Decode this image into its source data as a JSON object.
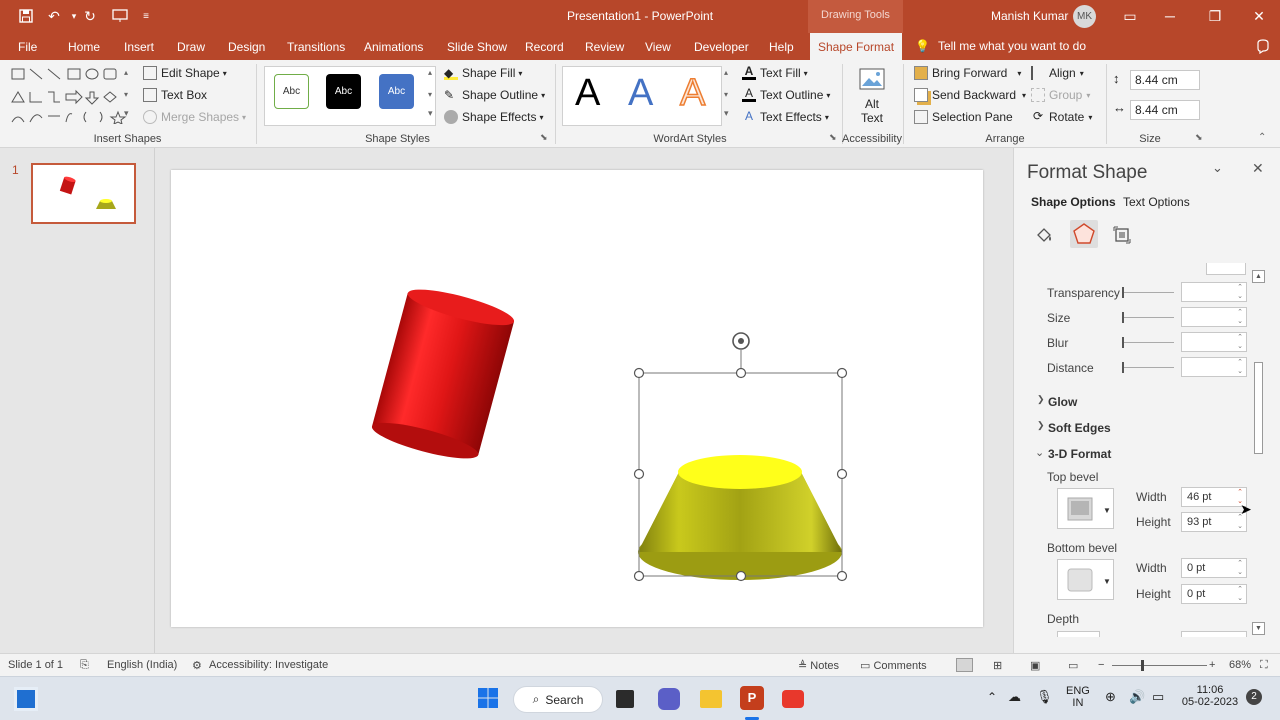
{
  "titlebar": {
    "title": "Presentation1 - PowerPoint",
    "context_label": "Drawing Tools",
    "user": "Manish Kumar",
    "avatar": "MK"
  },
  "tabs": [
    "File",
    "Home",
    "Insert",
    "Draw",
    "Design",
    "Transitions",
    "Animations",
    "Slide Show",
    "Record",
    "Review",
    "View",
    "Developer",
    "Help",
    "Shape Format"
  ],
  "tell_me": "Tell me what you want to do",
  "ribbon": {
    "insert_shapes": {
      "edit_shape": "Edit Shape",
      "text_box": "Text Box",
      "merge_shapes": "Merge Shapes",
      "label": "Insert Shapes"
    },
    "shape_styles": {
      "abc": "Abc",
      "fill": "Shape Fill",
      "outline": "Shape Outline",
      "effects": "Shape Effects",
      "label": "Shape Styles"
    },
    "wordart": {
      "letter": "A",
      "fill": "Text Fill",
      "outline": "Text Outline",
      "effects": "Text Effects",
      "label": "WordArt Styles"
    },
    "accessibility": {
      "alt_text_1": "Alt",
      "alt_text_2": "Text",
      "label": "Accessibility"
    },
    "arrange": {
      "bring_forward": "Bring Forward",
      "send_backward": "Send Backward",
      "selection_pane": "Selection Pane",
      "align": "Align",
      "group": "Group",
      "rotate": "Rotate",
      "label": "Arrange"
    },
    "size": {
      "height": "8.44 cm",
      "width": "8.44 cm",
      "label": "Size"
    }
  },
  "thumbs": {
    "slide_number": "1"
  },
  "format_pane": {
    "title": "Format Shape",
    "tab_shape": "Shape Options",
    "tab_text": "Text Options",
    "shadow_props": [
      "Transparency",
      "Size",
      "Blur",
      "Distance"
    ],
    "glow": "Glow",
    "soft_edges": "Soft Edges",
    "three_d": "3-D Format",
    "top_bevel": "Top bevel",
    "bottom_bevel": "Bottom bevel",
    "depth": "Depth",
    "width_label": "Width",
    "height_label": "Height",
    "top_width": "46 pt",
    "top_height": "93 pt",
    "bottom_width": "0 pt",
    "bottom_height": "0 pt"
  },
  "status": {
    "slide": "Slide 1 of 1",
    "language": "English (India)",
    "accessibility": "Accessibility: Investigate",
    "notes": "Notes",
    "comments": "Comments",
    "zoom": "68%"
  },
  "taskbar": {
    "search": "Search",
    "lang1": "ENG",
    "lang2": "IN",
    "time": "11:06",
    "date": "05-02-2023",
    "badge": "2"
  },
  "colors": {
    "accent": "#b7472a",
    "cylinder": "#e31a1a",
    "frustum": "#b5b51c",
    "frustum_top": "#ffff1a"
  }
}
